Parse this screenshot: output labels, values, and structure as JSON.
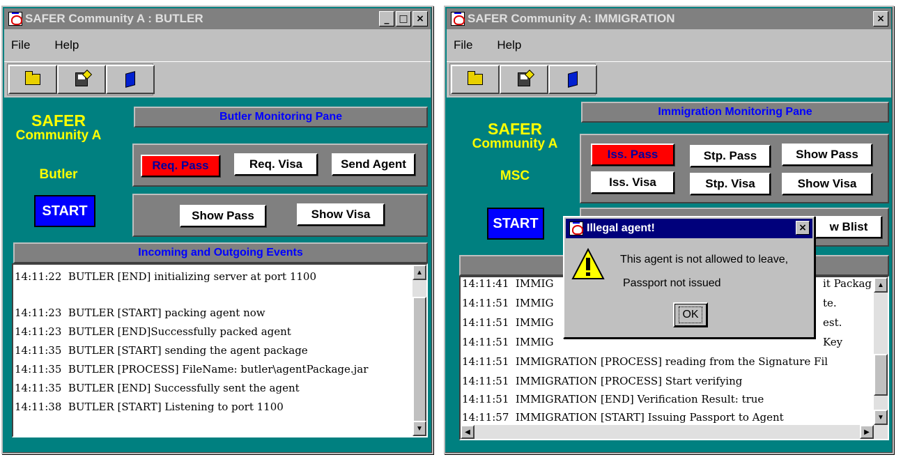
{
  "butler": {
    "title": "SAFER Community A : BUTLER",
    "menu": [
      "File",
      "Help"
    ],
    "logo_line1": "SAFER",
    "logo_line2": "Community A",
    "role": "Butler",
    "start_label": "START",
    "monitor_header": "Butler Monitoring Pane",
    "buttons_row1": [
      "Req. Pass",
      "Req. Visa",
      "Send Agent"
    ],
    "buttons_row2": [
      "Show Pass",
      "Show Visa"
    ],
    "events_header": "Incoming and Outgoing Events",
    "log": [
      "14:11:22  BUTLER [END] initializing server at port 1100",
      "",
      "14:11:23  BUTLER [START] packing agent now",
      "14:11:23  BUTLER [END]Successfully packed agent",
      "14:11:35  BUTLER [START] sending the agent package",
      "14:11:35  BUTLER [PROCESS] FileName: butler\\agentPackage.jar",
      "14:11:35  BUTLER [END] Successfully sent the agent",
      "14:11:38  BUTLER [START] Listening to port 1100"
    ]
  },
  "immigration": {
    "title": "SAFER Community A: IMMIGRATION",
    "menu": [
      "File",
      "Help"
    ],
    "logo_line1": "SAFER",
    "logo_line2": "Community A",
    "role": "MSC",
    "start_label": "START",
    "monitor_header": "Immigration Monitoring Pane",
    "buttons_row1": [
      "Iss. Pass",
      "Stp. Pass",
      "Show Pass"
    ],
    "buttons_row2": [
      "Iss. Visa",
      "Stp. Visa",
      "Show Visa"
    ],
    "partial_button": "w Blist",
    "log": [
      "14:11:41  IMMIG",
      "14:11:51  IMMIG",
      "14:11:51  IMMIG",
      "14:11:51  IMMIG",
      "14:11:51  IMMIGRATION [PROCESS] reading from the Signature Fil",
      "14:11:51  IMMIGRATION [PROCESS] Start verifying",
      "14:11:51  IMMIGRATION [END] Verification Result: true",
      "14:11:57  IMMIGRATION [START] Issuing Passport to Agent"
    ],
    "log_tails": [
      "it Packag",
      "te.",
      "est.",
      "Key"
    ]
  },
  "dialog": {
    "title": "Illegal agent!",
    "message_line1": "This agent is not allowed to leave,",
    "message_line2": "Passport not issued",
    "ok_label": "OK"
  },
  "colors": {
    "window_bg": "#008080",
    "logo_text": "#ffff00",
    "start_button": "#0000ff",
    "active_button": "#ff0000",
    "pane_header_text": "#0000ff"
  }
}
